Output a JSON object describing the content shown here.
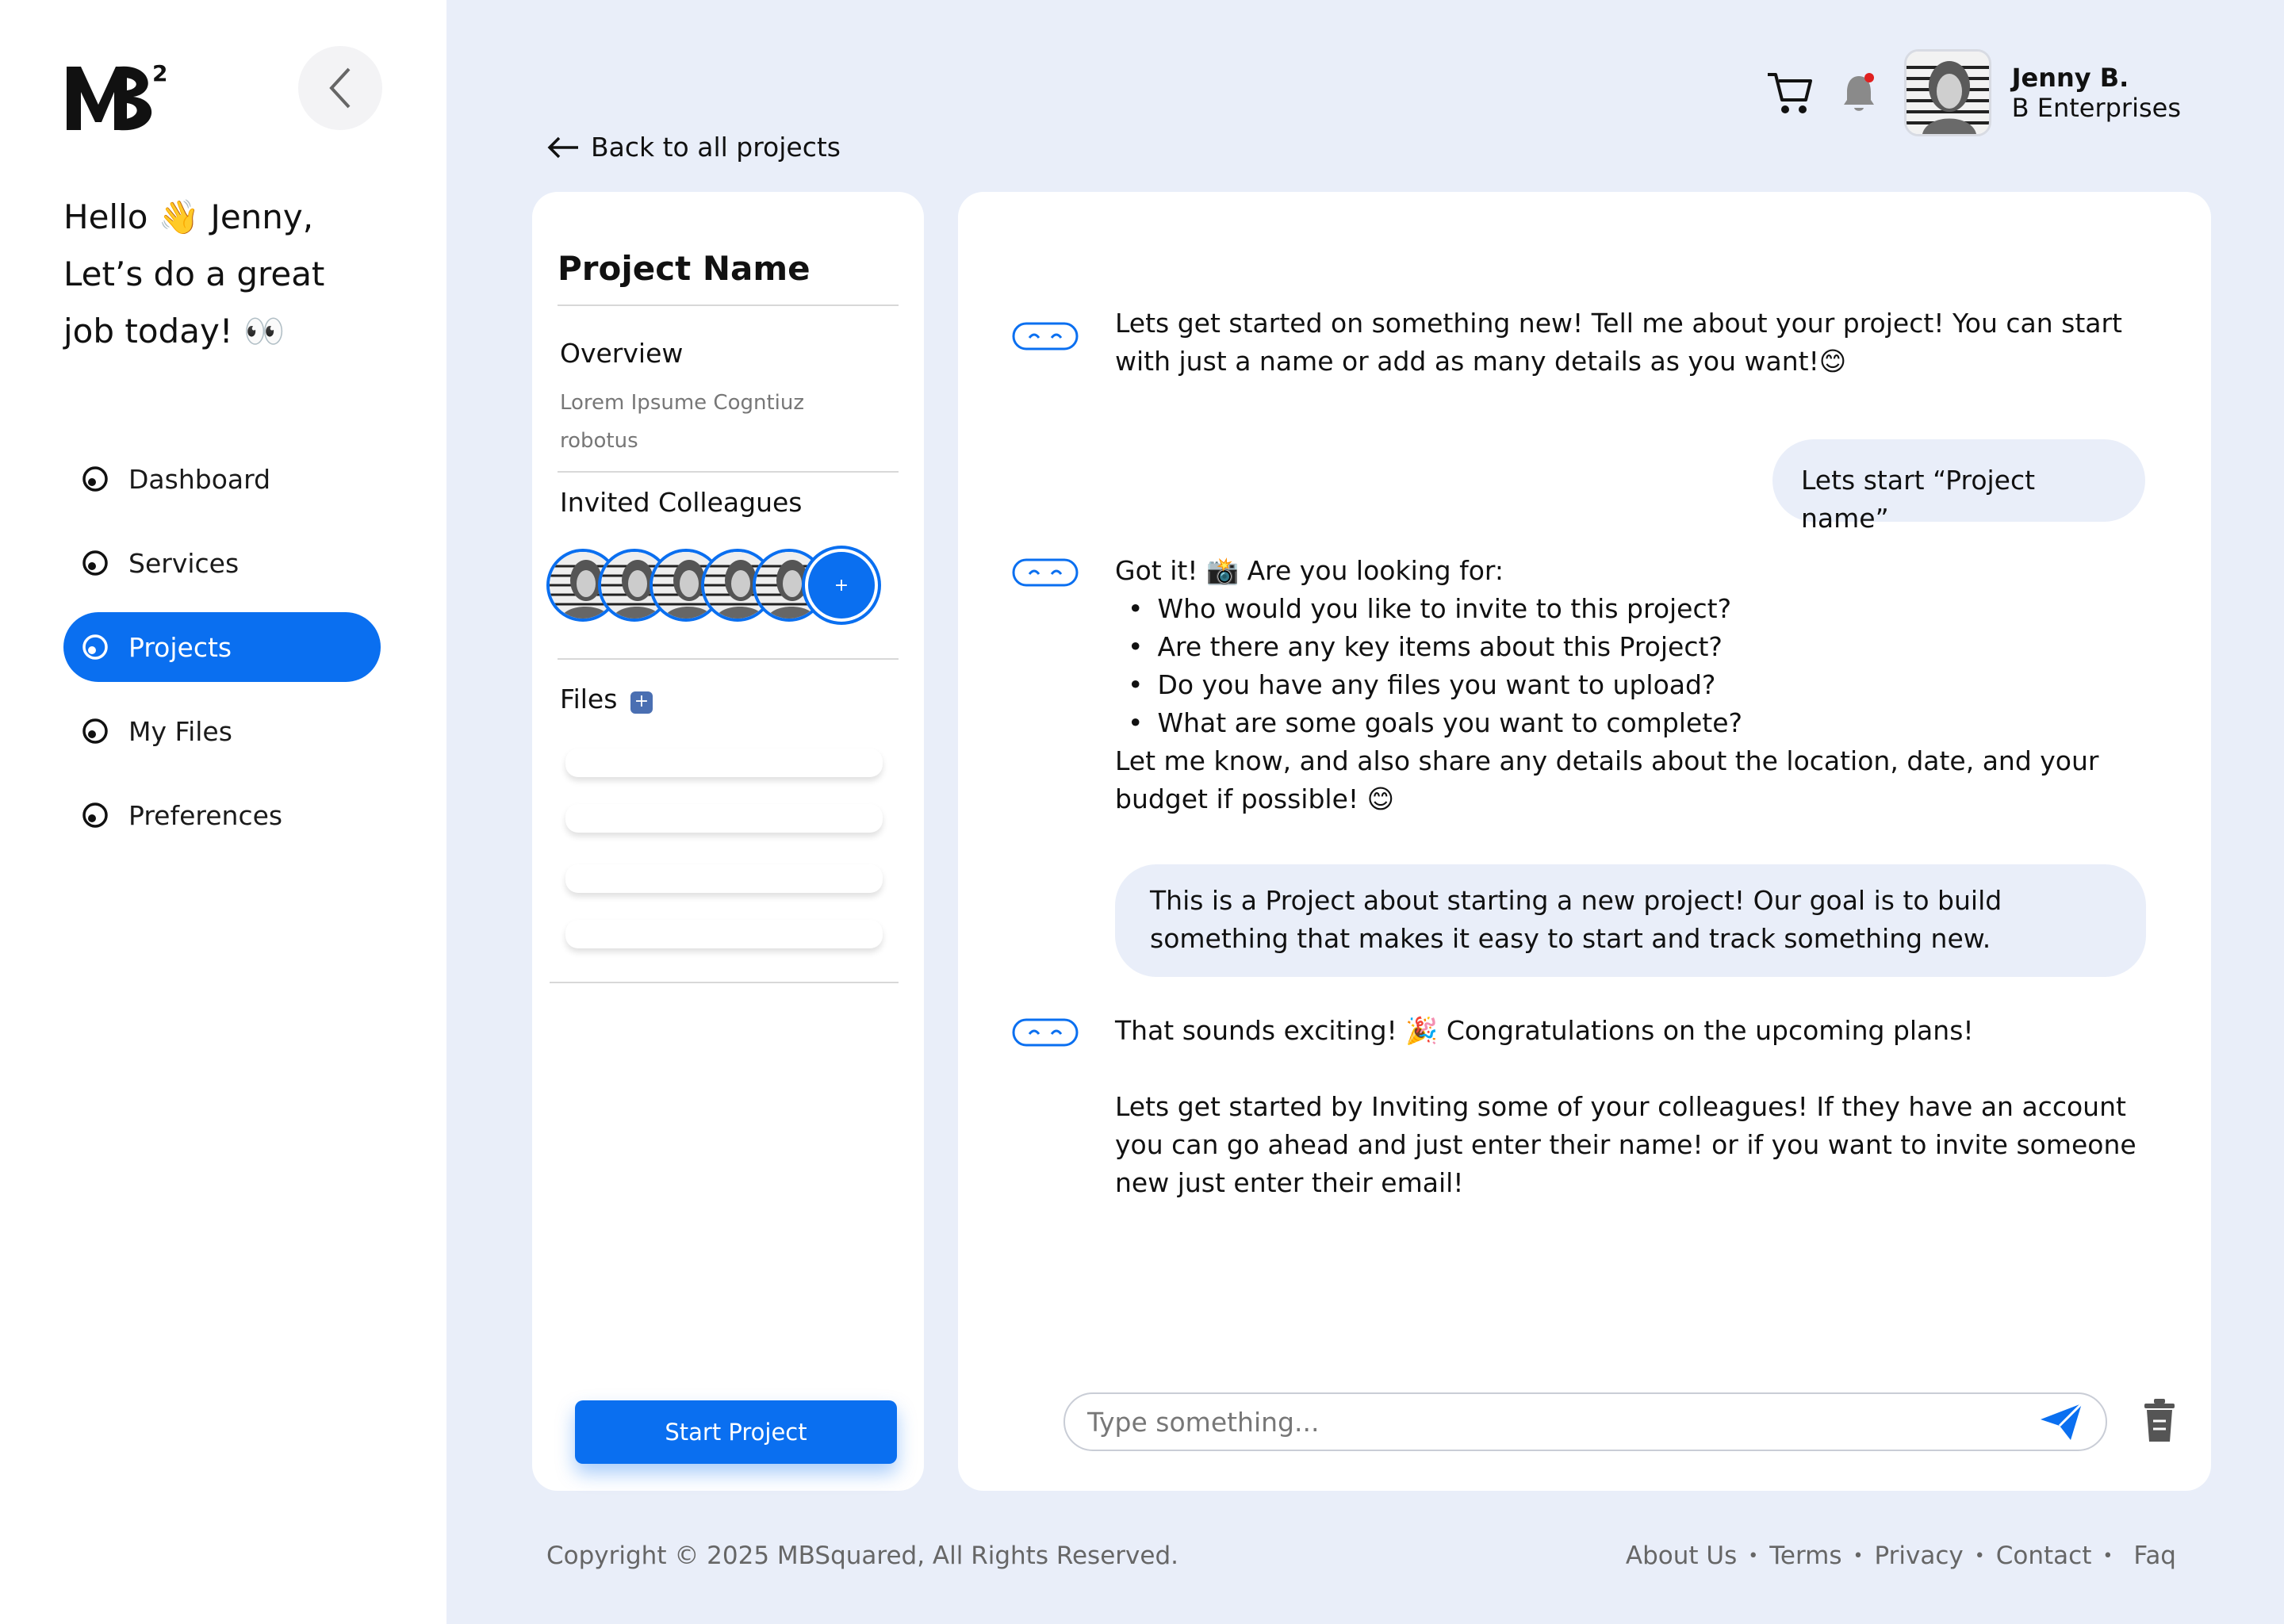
{
  "brand": {
    "logo_text": "MB²",
    "accent_color": "#0a6ff0"
  },
  "sidebar": {
    "greeting_line1": "Hello 👋 Jenny,",
    "greeting_line2": "Let’s do a great",
    "greeting_line3": "job today! 👀",
    "items": [
      {
        "label": "Dashboard",
        "active": false
      },
      {
        "label": "Services",
        "active": false
      },
      {
        "label": "Projects",
        "active": true
      },
      {
        "label": "My Files",
        "active": false
      },
      {
        "label": "Preferences",
        "active": false
      }
    ]
  },
  "header": {
    "user_name": "Jenny B.",
    "user_company": "B Enterprises",
    "notification_dot_color": "#e02020"
  },
  "back_link": "Back to all projects",
  "project_panel": {
    "title": "Project Name",
    "overview_label": "Overview",
    "overview_text": "Lorem Ipsume Cogntiuz robotus",
    "colleagues_label": "Invited Colleagues",
    "add_colleague": "+",
    "files_label": "Files",
    "files_add": "+",
    "start_button": "Start Project"
  },
  "chat": {
    "bot_msg_1": "Lets get started on something new! Tell me about your project! You can start with just a name or add as many details as you want!😊",
    "user_msg_1": "Lets start “Project name”",
    "bot_msg_2_intro": "Got it! 📸 Are you looking for:",
    "bot_msg_2_items": [
      "Who would you like to invite to this project?",
      "Are there any key items about this Project?",
      "Do you have any files you want to upload?",
      "What are some goals you want to complete?"
    ],
    "bot_msg_2_outro": "Let me know, and also share any details about the location, date, and your budget if possible! 😊",
    "user_msg_2": "This is a Project about starting a new project! Our goal is to build something that makes it easy to start and track something new.",
    "bot_msg_3_line1": "That sounds exciting! 🎉 Congratulations on the upcoming plans!",
    "bot_msg_3_line2": "Lets get started by Inviting some of your colleagues! If they have an account you can go ahead and just enter their name! or if you want to invite someone new just enter their email!",
    "input_placeholder": "Type something..."
  },
  "footer": {
    "copyright": "Copyright © 2025 MBSquared, All Rights Reserved.",
    "links": [
      "About Us",
      "Terms",
      "Privacy",
      "Contact",
      "Faq"
    ]
  }
}
